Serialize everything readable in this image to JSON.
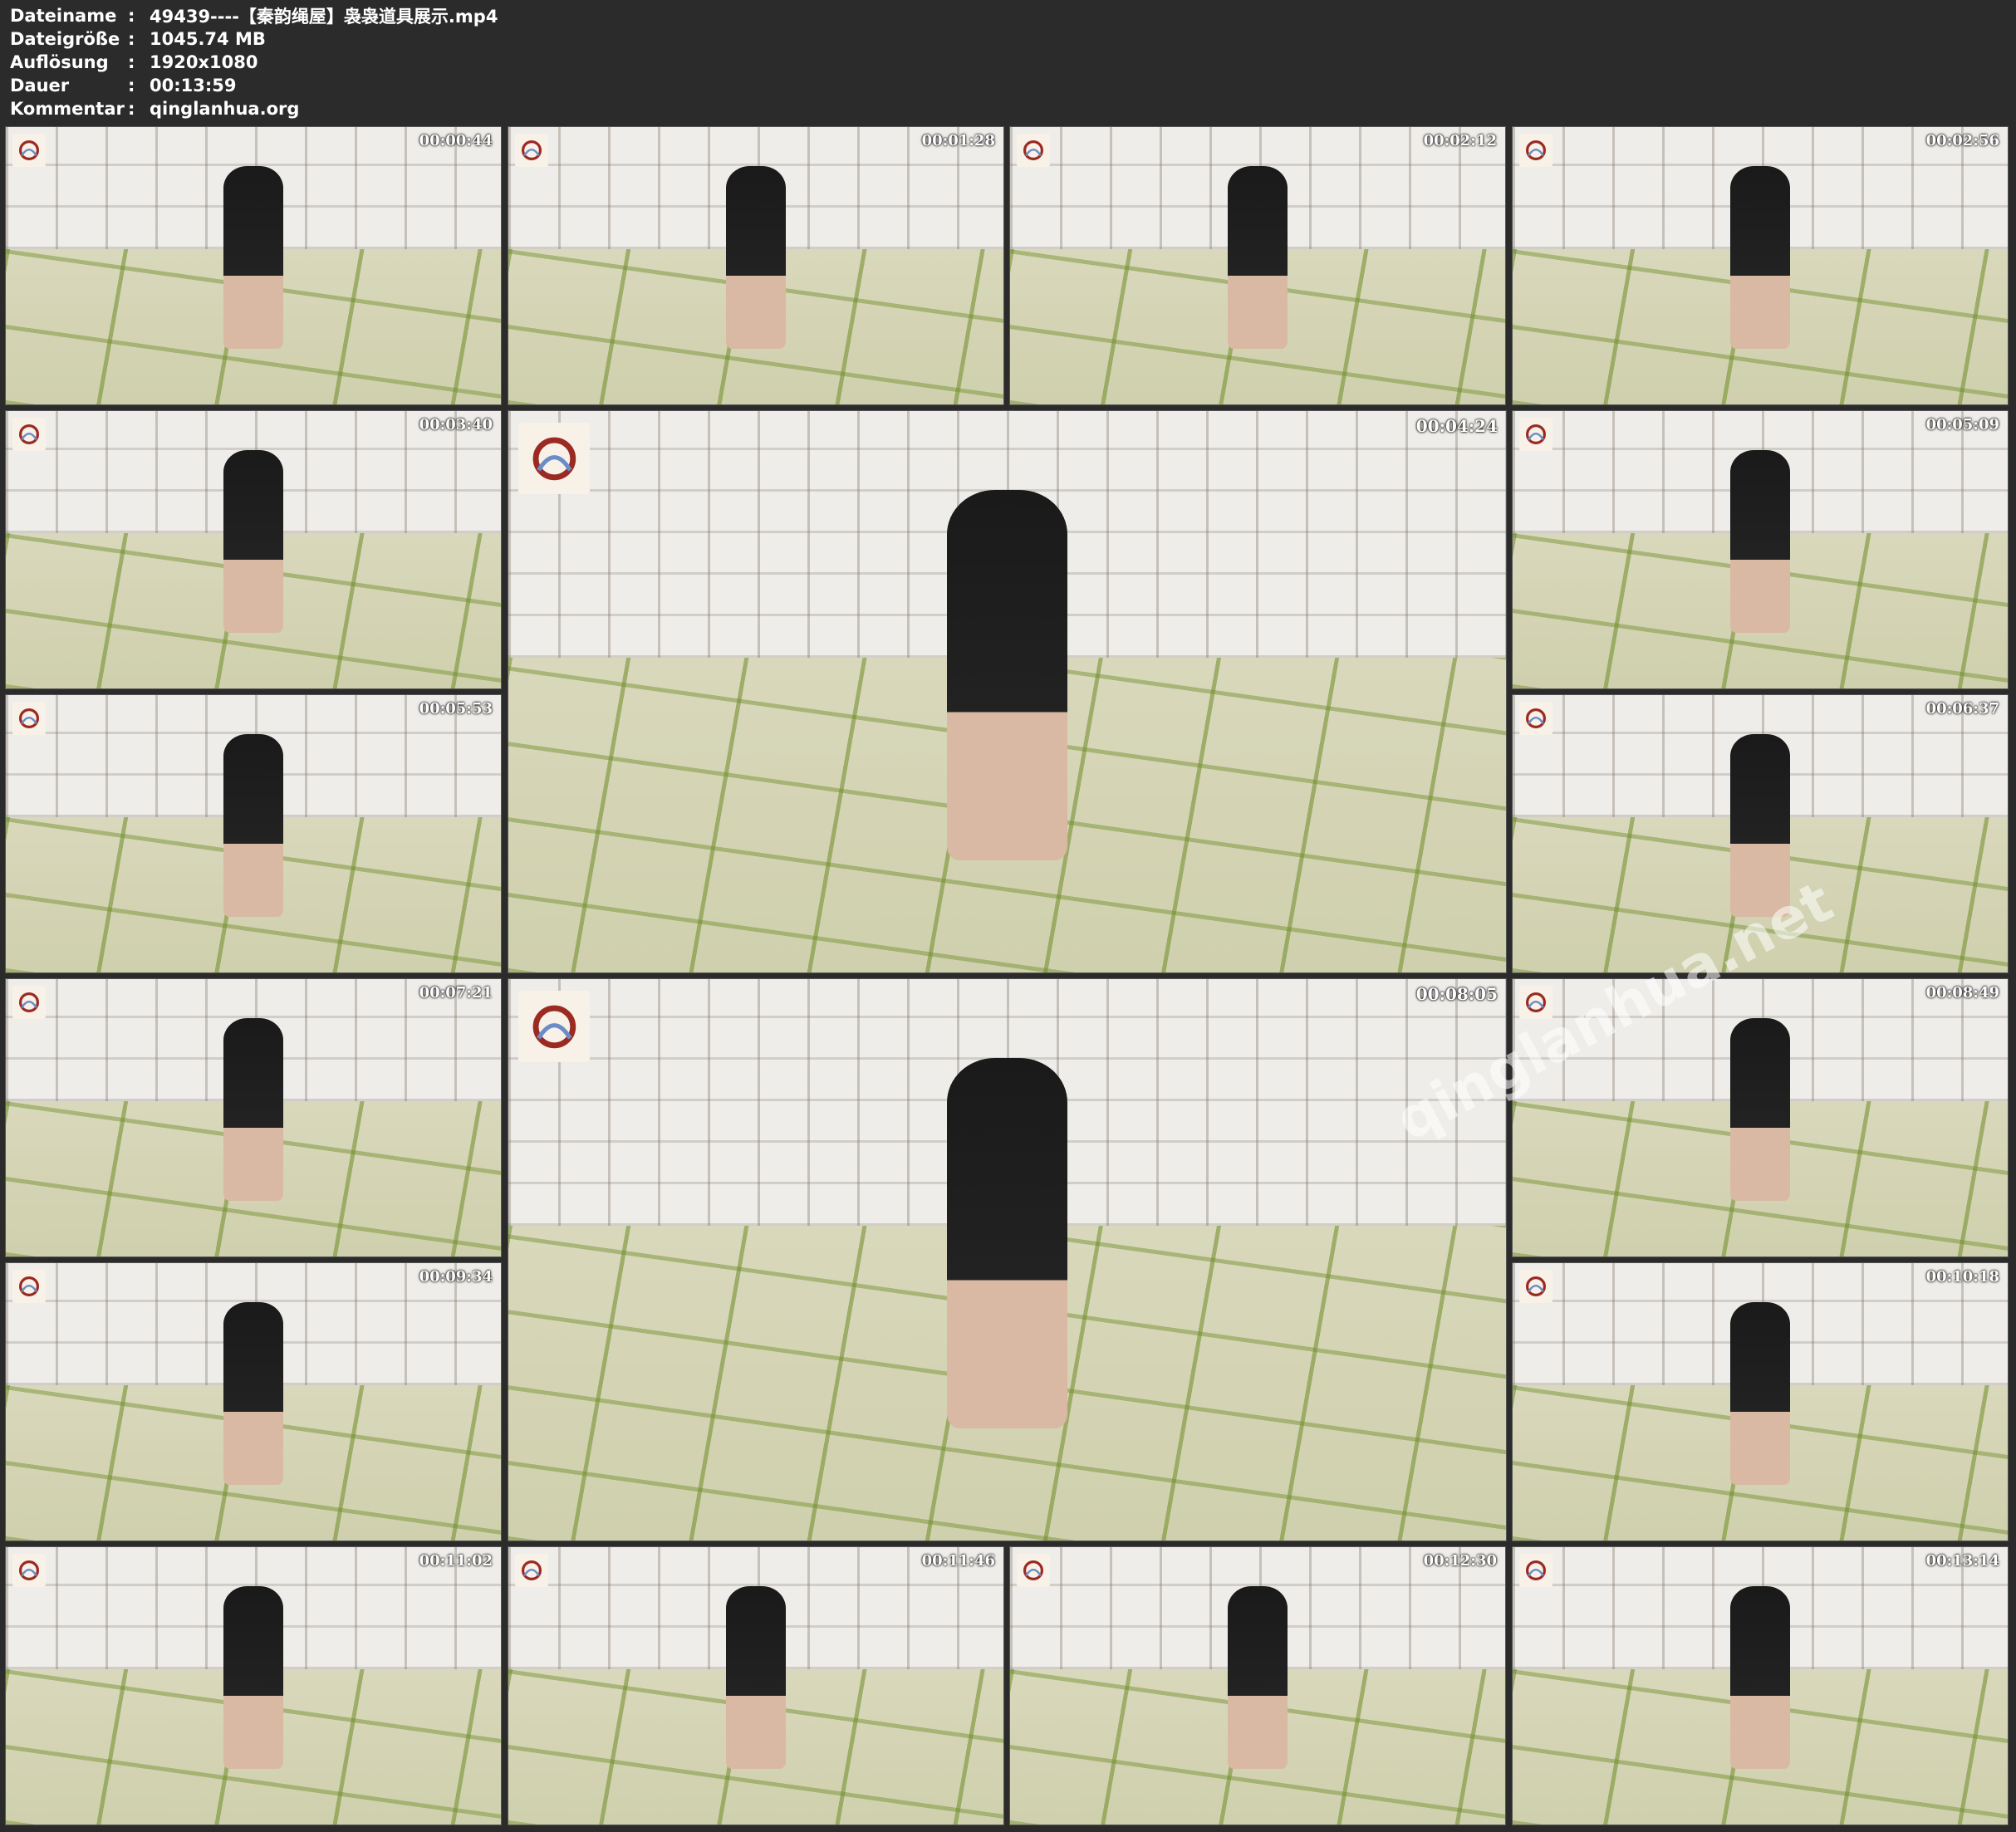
{
  "header": {
    "rows": [
      {
        "key": "Dateiname",
        "sep": ":",
        "value": "49439----【秦韵绳屋】袅袅道具展示.mp4"
      },
      {
        "key": "Dateigröße",
        "sep": ":",
        "value": "1045.74 MB"
      },
      {
        "key": "Auflösung",
        "sep": ":",
        "value": "1920x1080"
      },
      {
        "key": "Dauer",
        "sep": ":",
        "value": "00:13:59"
      },
      {
        "key": "Kommentar",
        "sep": ":",
        "value": "qinglanhua.org"
      }
    ]
  },
  "thumbnails": [
    {
      "timestamp": "00:00:44"
    },
    {
      "timestamp": "00:01:28"
    },
    {
      "timestamp": "00:02:12"
    },
    {
      "timestamp": "00:02:56"
    },
    {
      "timestamp": "00:03:40"
    },
    {
      "timestamp": "00:04:24"
    },
    {
      "timestamp": "00:05:09"
    },
    {
      "timestamp": "00:05:53"
    },
    {
      "timestamp": "00:06:37"
    },
    {
      "timestamp": "00:07:21"
    },
    {
      "timestamp": "00:08:05"
    },
    {
      "timestamp": "00:08:49"
    },
    {
      "timestamp": "00:09:34"
    },
    {
      "timestamp": "00:10:18"
    },
    {
      "timestamp": "00:11:02"
    },
    {
      "timestamp": "00:11:46"
    },
    {
      "timestamp": "00:12:30"
    },
    {
      "timestamp": "00:13:14"
    }
  ],
  "watermark": "qinglanhua.net",
  "logo_icon": "rope-seal-logo-icon"
}
